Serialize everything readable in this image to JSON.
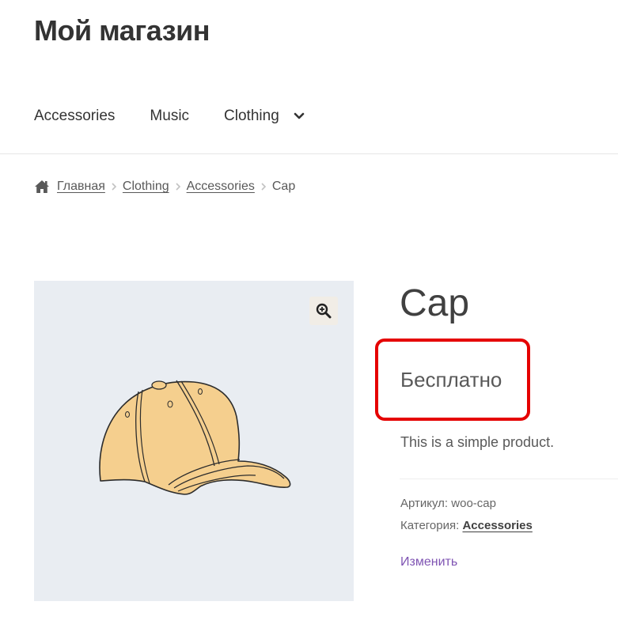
{
  "site": {
    "title": "Мой магазин"
  },
  "nav": {
    "items": [
      {
        "label": "Accessories"
      },
      {
        "label": "Music"
      },
      {
        "label": "Clothing"
      }
    ]
  },
  "breadcrumb": {
    "home": "Главная",
    "path": [
      "Clothing",
      "Accessories"
    ],
    "current": "Cap"
  },
  "product": {
    "title": "Cap",
    "price": "Бесплатно",
    "description": "This is a simple product.",
    "sku_label": "Артикул:",
    "sku": "woo-cap",
    "category_label": "Категория:",
    "category": "Accessories",
    "edit_label": "Изменить"
  },
  "colors": {
    "highlight": "#e50000",
    "link": "#7f54b3",
    "gallery_bg": "#e9edf2",
    "cap": "#f5cf8e"
  },
  "icons": [
    "chevron-down-icon",
    "home-icon",
    "chevron-right-icon",
    "zoom-icon"
  ]
}
